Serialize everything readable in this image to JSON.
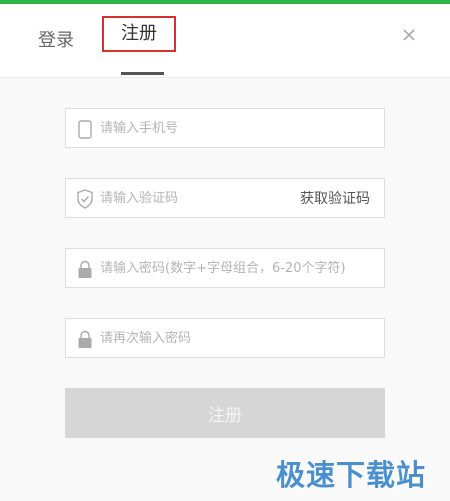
{
  "colors": {
    "accent": "#2fb44a",
    "highlight_border": "#d9302a",
    "button_disabled": "#d6d6d6",
    "watermark": "#4a8fd0"
  },
  "tabs": {
    "login_label": "登录",
    "register_label": "注册"
  },
  "icons": {
    "close": "close-icon",
    "phone": "phone-icon",
    "shield": "shield-check-icon",
    "lock": "lock-icon"
  },
  "form": {
    "phone_placeholder": "请输入手机号",
    "code_placeholder": "请输入验证码",
    "get_code_label": "获取验证码",
    "password_placeholder": "请输入密码(数字+字母组合，6-20个字符)",
    "confirm_password_placeholder": "请再次输入密码",
    "submit_label": "注册"
  },
  "watermark": "极速下载站"
}
